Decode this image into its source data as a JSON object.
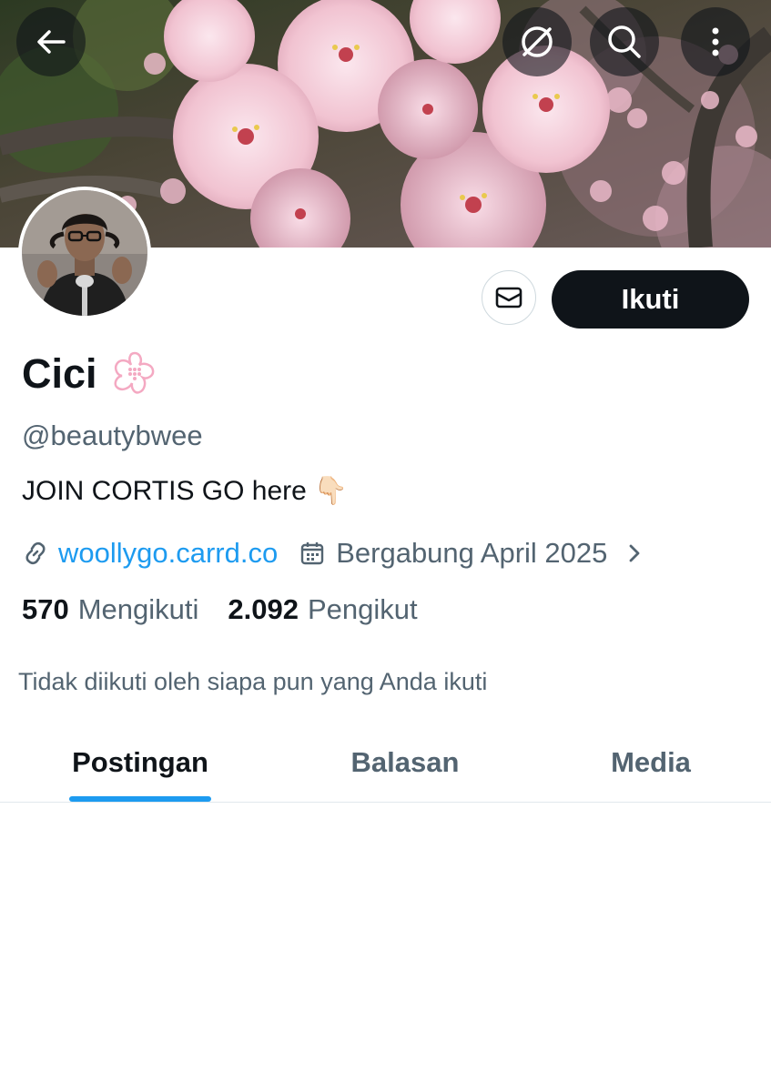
{
  "header": {
    "back_icon": "arrow-left-icon",
    "grok_icon": "grok-icon",
    "search_icon": "search-icon",
    "more_icon": "more-vertical-icon"
  },
  "profile": {
    "display_name": "Cici",
    "name_emoji_icon": "cherry-blossom-icon",
    "handle": "@beautybwee",
    "bio": "JOIN CORTIS GO here",
    "bio_emoji": "👇🏻",
    "link": "woollygo.carrd.co",
    "joined": "Bergabung April 2025",
    "following_count": "570",
    "following_label": "Mengikuti",
    "followers_count": "2.092",
    "followers_label": "Pengikut",
    "followed_note": "Tidak diikuti oleh siapa pun yang Anda ikuti"
  },
  "actions": {
    "message_icon": "mail-icon",
    "follow_label": "Ikuti"
  },
  "tabs": [
    {
      "label": "Postingan",
      "active": true
    },
    {
      "label": "Balasan",
      "active": false
    },
    {
      "label": "Media",
      "active": false
    }
  ],
  "colors": {
    "accent": "#1d9bf0",
    "text_primary": "#0f1419",
    "text_secondary": "#536471",
    "blossom_pink": "#f4a9c2"
  }
}
